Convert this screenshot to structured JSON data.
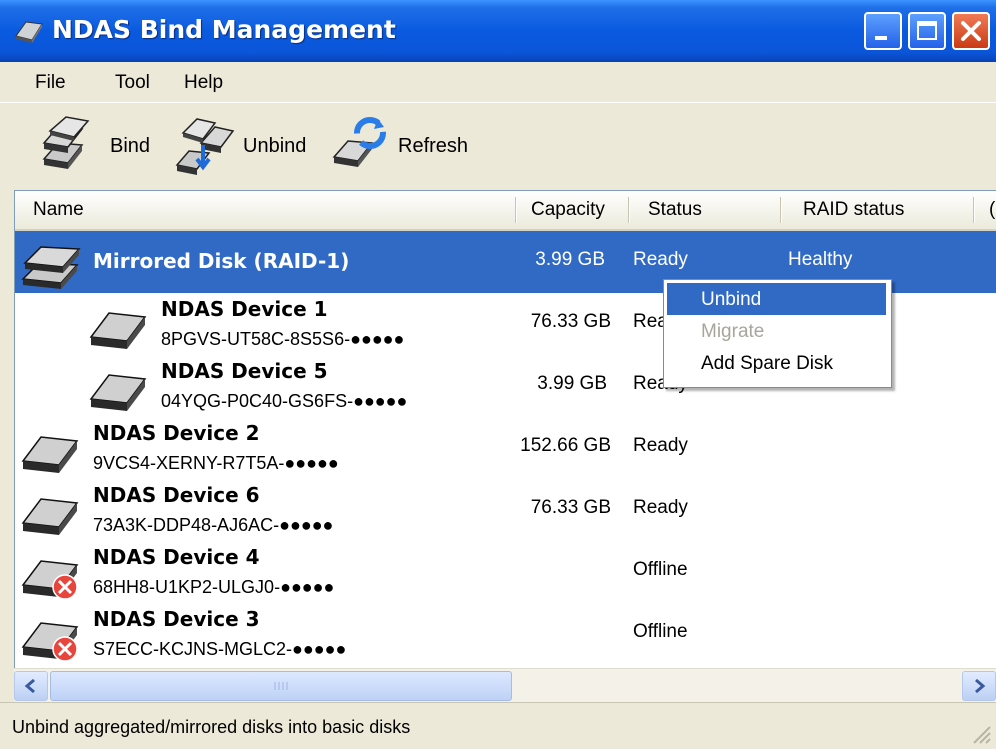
{
  "window": {
    "title": "NDAS Bind Management",
    "app_icon": "ndas-disk-icon",
    "controls": [
      "minimize-icon",
      "maximize-icon",
      "close-icon"
    ]
  },
  "menubar": {
    "items": [
      "File",
      "Tool",
      "Help"
    ]
  },
  "toolbar": {
    "buttons": [
      {
        "label": "Bind",
        "icon": "bind-disks-icon"
      },
      {
        "label": "Unbind",
        "icon": "unbind-disks-icon"
      },
      {
        "label": "Refresh",
        "icon": "refresh-icon"
      }
    ]
  },
  "list": {
    "columns": [
      "Name",
      "Capacity",
      "Status",
      "RAID status",
      "("
    ],
    "rows": [
      {
        "name": "Mirrored Disk (RAID-1)",
        "serial": "",
        "capacity": "3.99 GB",
        "status": "Ready",
        "raid_status": "Healthy",
        "icon": "mirrored-disk-icon",
        "selected": true,
        "indent": 0
      },
      {
        "name": "NDAS Device 1",
        "serial": "8PGVS-UT58C-8S5S6-●●●●●",
        "capacity": "76.33 GB",
        "status": "Ready",
        "raid_status": "",
        "icon": "disk-icon",
        "indent": 1
      },
      {
        "name": "NDAS Device 5",
        "serial": "04YQG-P0C40-GS6FS-●●●●●",
        "capacity": "3.99 GB",
        "status": "Ready",
        "raid_status": "",
        "icon": "disk-icon",
        "indent": 1
      },
      {
        "name": "NDAS Device 2",
        "serial": "9VCS4-XERNY-R7T5A-●●●●●",
        "capacity": "152.66 GB",
        "status": "Ready",
        "raid_status": "",
        "icon": "disk-icon",
        "indent": 0
      },
      {
        "name": "NDAS Device 6",
        "serial": "73A3K-DDP48-AJ6AC-●●●●●",
        "capacity": "76.33 GB",
        "status": "Ready",
        "raid_status": "",
        "icon": "disk-icon",
        "indent": 0
      },
      {
        "name": "NDAS Device 4",
        "serial": "68HH8-U1KP2-ULGJ0-●●●●●",
        "capacity": "",
        "status": "Offline",
        "raid_status": "",
        "icon": "disk-offline-icon",
        "indent": 0
      },
      {
        "name": "NDAS Device 3",
        "serial": "S7ECC-KCJNS-MGLC2-●●●●●",
        "capacity": "",
        "status": "Offline",
        "raid_status": "",
        "icon": "disk-offline-icon",
        "indent": 0
      }
    ]
  },
  "context_menu": {
    "items": [
      {
        "label": "Unbind",
        "state": "highlighted"
      },
      {
        "label": "Migrate",
        "state": "disabled"
      },
      {
        "label": "Add Spare Disk",
        "state": "normal"
      }
    ]
  },
  "statusbar": {
    "text": "Unbind aggregated/mirrored disks into basic disks"
  },
  "colors": {
    "selection": "#316ac5",
    "titlebar": "#0a5ae0",
    "offline_badge": "#e8453c"
  }
}
